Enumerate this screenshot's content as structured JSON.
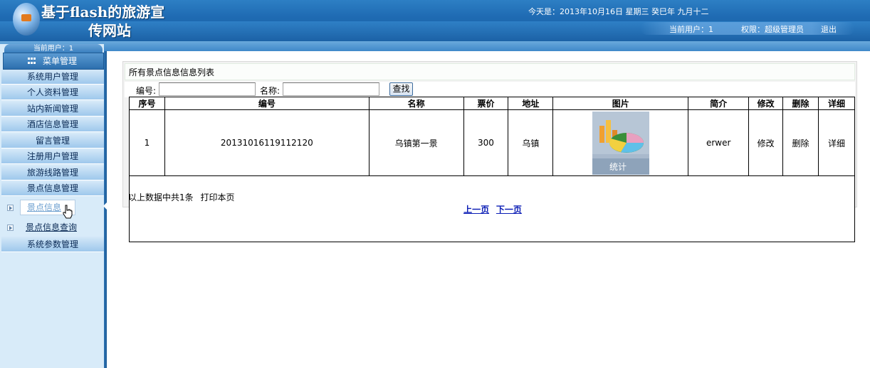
{
  "header": {
    "title_line1": "基于flash的旅游宣",
    "title_line2": "传网站",
    "date_text": "今天是：2013年10月16日 星期三 癸巳年 九月十二",
    "current_user": "当前用户：1",
    "permission": "权限：超级管理员",
    "logout": "退出"
  },
  "sidebar": {
    "top_tab": "当前用户：1",
    "menu_header": "菜单管理",
    "items": [
      "系统用户管理",
      "个人资料管理",
      "站内新闻管理",
      "酒店信息管理",
      "留言管理",
      "注册用户管理",
      "旅游线路管理",
      "景点信息管理"
    ],
    "sub_items": [
      "景点信息",
      "景点信息查询"
    ],
    "last_item": "系统参数管理"
  },
  "main": {
    "panel_title": "所有景点信息信息列表",
    "search": {
      "label_code": "编号:",
      "label_name": "名称:",
      "code_value": "",
      "name_value": "",
      "button": "查找"
    },
    "columns": [
      "序号",
      "编号",
      "名称",
      "票价",
      "地址",
      "图片",
      "简介",
      "修改",
      "删除",
      "详细"
    ],
    "rows": [
      {
        "index": "1",
        "code": "20131016119112120",
        "name": "乌镇第一景",
        "price": "300",
        "address": "乌镇",
        "image_caption": "统计",
        "intro": "erwer",
        "edit": "修改",
        "delete": "删除",
        "detail": "详细"
      }
    ],
    "pager": {
      "prev": "上一页",
      "next": "下一页"
    },
    "summary": "以上数据中共1条",
    "print": "打印本页"
  }
}
